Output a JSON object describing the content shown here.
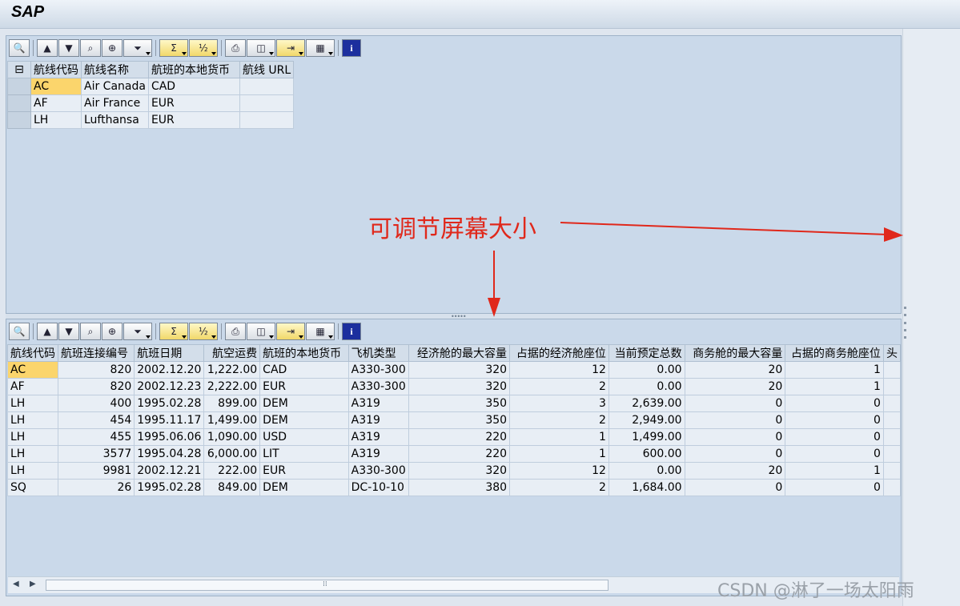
{
  "app": {
    "title": "SAP"
  },
  "top_table": {
    "headers": [
      "航线代码",
      "航线名称",
      "航班的本地货币",
      "航线 URL"
    ],
    "rows": [
      [
        "AC",
        "Air Canada",
        "CAD",
        ""
      ],
      [
        "AF",
        "Air France",
        "EUR",
        ""
      ],
      [
        "LH",
        "Lufthansa",
        "EUR",
        ""
      ]
    ]
  },
  "bottom_table": {
    "headers": [
      "航线代码",
      "航班连接编号",
      "航班日期",
      "航空运费",
      "航班的本地货币",
      "飞机类型",
      "经济舱的最大容量",
      "占据的经济舱座位",
      "当前预定总数",
      "商务舱的最大容量",
      "占据的商务舱座位",
      "头"
    ],
    "rows": [
      [
        "AC",
        "820",
        "2002.12.20",
        "1,222.00",
        "CAD",
        "A330-300",
        "320",
        "12",
        "0.00",
        "20",
        "1"
      ],
      [
        "AF",
        "820",
        "2002.12.23",
        "2,222.00",
        "EUR",
        "A330-300",
        "320",
        "2",
        "0.00",
        "20",
        "1"
      ],
      [
        "LH",
        "400",
        "1995.02.28",
        "899.00",
        "DEM",
        "A319",
        "350",
        "3",
        "2,639.00",
        "0",
        "0"
      ],
      [
        "LH",
        "454",
        "1995.11.17",
        "1,499.00",
        "DEM",
        "A319",
        "350",
        "2",
        "2,949.00",
        "0",
        "0"
      ],
      [
        "LH",
        "455",
        "1995.06.06",
        "1,090.00",
        "USD",
        "A319",
        "220",
        "1",
        "1,499.00",
        "0",
        "0"
      ],
      [
        "LH",
        "3577",
        "1995.04.28",
        "6,000.00",
        "LIT",
        "A319",
        "220",
        "1",
        "600.00",
        "0",
        "0"
      ],
      [
        "LH",
        "9981",
        "2002.12.21",
        "222.00",
        "EUR",
        "A330-300",
        "320",
        "12",
        "0.00",
        "20",
        "1"
      ],
      [
        "SQ",
        "26",
        "1995.02.28",
        "849.00",
        "DEM",
        "DC-10-10",
        "380",
        "2",
        "1,684.00",
        "0",
        "0"
      ]
    ]
  },
  "annotation": {
    "text": "可调节屏幕大小",
    "color": "#e0281b"
  },
  "watermark": {
    "text": "CSDN @淋了一场太阳雨"
  },
  "colors": {
    "selected_cell": "#fbd56c",
    "panel_bg": "#cad9ea",
    "info_button": "#1c2f9e"
  }
}
